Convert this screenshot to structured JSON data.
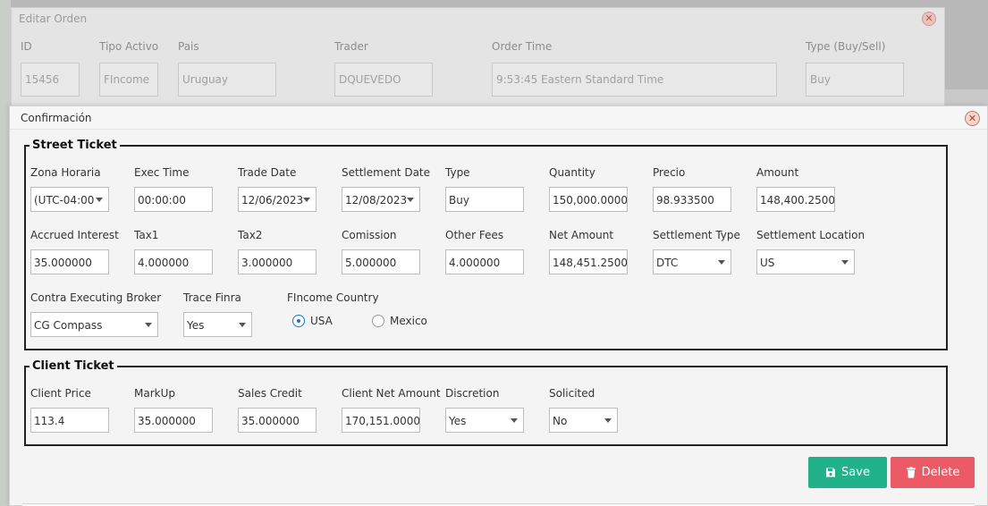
{
  "background": {
    "window_title": "Editar Orden",
    "fields": [
      {
        "label": "ID",
        "value": "15456"
      },
      {
        "label": "Tipo Activo",
        "value": "FIncome"
      },
      {
        "label": "Pais",
        "value": "Uruguay"
      },
      {
        "label": "Trader",
        "value": "DQUEVEDO"
      },
      {
        "label": "Order Time",
        "value": "9:53:45 Eastern Standard Time"
      },
      {
        "label": "Type (Buy/Sell)",
        "value": "Buy"
      }
    ]
  },
  "dialog": {
    "title": "Confirmación",
    "street_ticket": {
      "legend": "Street Ticket",
      "zona_horaria": {
        "label": "Zona Horaria",
        "value": "(UTC-04:00"
      },
      "exec_time": {
        "label": "Exec Time",
        "value": "00:00:00"
      },
      "trade_date": {
        "label": "Trade Date",
        "value": "12/06/2023"
      },
      "settlement_date": {
        "label": "Settlement Date",
        "value": "12/08/2023"
      },
      "type": {
        "label": "Type",
        "value": "Buy"
      },
      "quantity": {
        "label": "Quantity",
        "value": "150,000.00000"
      },
      "precio": {
        "label": "Precio",
        "value": "98.933500"
      },
      "amount": {
        "label": "Amount",
        "value": "148,400.25000"
      },
      "accrued_interest": {
        "label": "Accrued Interest",
        "value": "35.000000"
      },
      "tax1": {
        "label": "Tax1",
        "value": "4.000000"
      },
      "tax2": {
        "label": "Tax2",
        "value": "3.000000"
      },
      "comission": {
        "label": "Comission",
        "value": "5.000000"
      },
      "other_fees": {
        "label": "Other Fees",
        "value": "4.000000"
      },
      "net_amount": {
        "label": "Net Amount",
        "value": "148,451.25000"
      },
      "settlement_type": {
        "label": "Settlement Type",
        "value": "DTC"
      },
      "settlement_location": {
        "label": "Settlement Location",
        "value": "US"
      },
      "contra_broker": {
        "label": "Contra Executing Broker",
        "value": "CG Compass"
      },
      "trace_finra": {
        "label": "Trace Finra",
        "value": "Yes"
      },
      "fincome_country": {
        "label": "FIncome Country",
        "options": [
          "USA",
          "Mexico"
        ],
        "selected": "USA"
      }
    },
    "client_ticket": {
      "legend": "Client Ticket",
      "client_price": {
        "label": "Client Price",
        "value": "113.4"
      },
      "markup": {
        "label": "MarkUp",
        "value": "35.000000"
      },
      "sales_credit": {
        "label": "Sales Credit",
        "value": "35.000000"
      },
      "client_net_amount": {
        "label": "Client Net Amount",
        "value": "170,151.00000"
      },
      "discretion": {
        "label": "Discretion",
        "value": "Yes"
      },
      "solicited": {
        "label": "Solicited",
        "value": "No"
      }
    },
    "buttons": {
      "save": "Save",
      "delete": "Delete"
    },
    "colors": {
      "save": "#22b28a",
      "delete": "#ec5a66",
      "radio_accent": "#1a73c7"
    },
    "icons": {
      "save": "floppy-disk-icon",
      "delete": "trash-icon",
      "close": "close-icon"
    }
  }
}
